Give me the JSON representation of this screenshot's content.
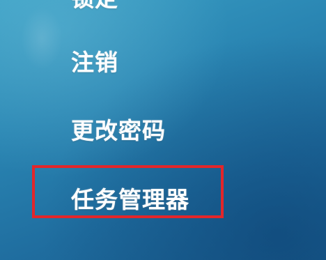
{
  "security_screen": {
    "items": [
      {
        "label": "锁定"
      },
      {
        "label": "注销"
      },
      {
        "label": "更改密码"
      },
      {
        "label": "任务管理器"
      }
    ]
  },
  "colors": {
    "background": "#2a86b3",
    "text": "#ffffff",
    "highlight_border": "#e3262a"
  }
}
